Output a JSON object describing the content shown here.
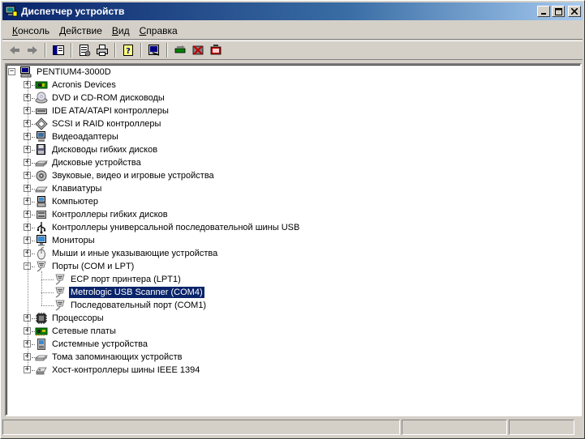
{
  "window": {
    "title": "Диспетчер устройств",
    "icon": "device-manager-icon"
  },
  "menu": [
    {
      "label": "Консоль",
      "access": "К",
      "rest": "онсоль"
    },
    {
      "label": "Действие",
      "access": "Д",
      "rest": "ействие"
    },
    {
      "label": "Вид",
      "access": "В",
      "rest": "ид"
    },
    {
      "label": "Справка",
      "access": "С",
      "rest": "правка"
    }
  ],
  "toolbar": [
    "back-arrow-icon",
    "forward-arrow-icon",
    "show-hide-tree-icon",
    "properties-icon",
    "print-icon",
    "help-icon",
    "scan-hardware-icon",
    "update-driver-icon",
    "disable-device-icon",
    "uninstall-device-icon"
  ],
  "tree": {
    "root": {
      "label": "PENTIUM4-3000D",
      "icon": "computer-icon"
    },
    "categories": [
      {
        "label": "Acronis Devices",
        "icon": "chip-board-icon"
      },
      {
        "label": "DVD и CD-ROM дисководы",
        "icon": "cd-drive-icon"
      },
      {
        "label": "IDE ATA/ATAPI контроллеры",
        "icon": "ide-controller-icon"
      },
      {
        "label": "SCSI и RAID контроллеры",
        "icon": "scsi-controller-icon"
      },
      {
        "label": "Видеоадаптеры",
        "icon": "display-adapter-icon"
      },
      {
        "label": "Дисководы гибких дисков",
        "icon": "floppy-drive-icon"
      },
      {
        "label": "Дисковые устройства",
        "icon": "disk-drive-icon"
      },
      {
        "label": "Звуковые, видео и игровые устройства",
        "icon": "speaker-icon"
      },
      {
        "label": "Клавиатуры",
        "icon": "keyboard-icon"
      },
      {
        "label": "Компьютер",
        "icon": "computer-small-icon"
      },
      {
        "label": "Контроллеры гибких дисков",
        "icon": "floppy-controller-icon"
      },
      {
        "label": "Контроллеры универсальной последовательной шины USB",
        "icon": "usb-icon"
      },
      {
        "label": "Мониторы",
        "icon": "monitor-icon"
      },
      {
        "label": "Мыши и иные указывающие устройства",
        "icon": "mouse-icon"
      },
      {
        "label": "Порты (COM и LPT)",
        "icon": "port-icon",
        "expanded": true,
        "children": [
          {
            "label": "ECP порт принтера (LPT1)",
            "icon": "port-icon"
          },
          {
            "label": "Metrologic USB Scanner (COM4)",
            "icon": "port-icon",
            "selected": true
          },
          {
            "label": "Последовательный порт (COM1)",
            "icon": "port-icon"
          }
        ]
      },
      {
        "label": "Процессоры",
        "icon": "cpu-icon"
      },
      {
        "label": "Сетевые платы",
        "icon": "network-card-icon"
      },
      {
        "label": "Системные устройства",
        "icon": "system-device-icon"
      },
      {
        "label": "Тома запоминающих устройств",
        "icon": "storage-volume-icon"
      },
      {
        "label": "Хост-контроллеры шины IEEE 1394",
        "icon": "ieee1394-icon"
      }
    ]
  },
  "colors": {
    "selection": "#0a246a",
    "titlebar": "#0a246a",
    "face": "#d4d0c8"
  }
}
